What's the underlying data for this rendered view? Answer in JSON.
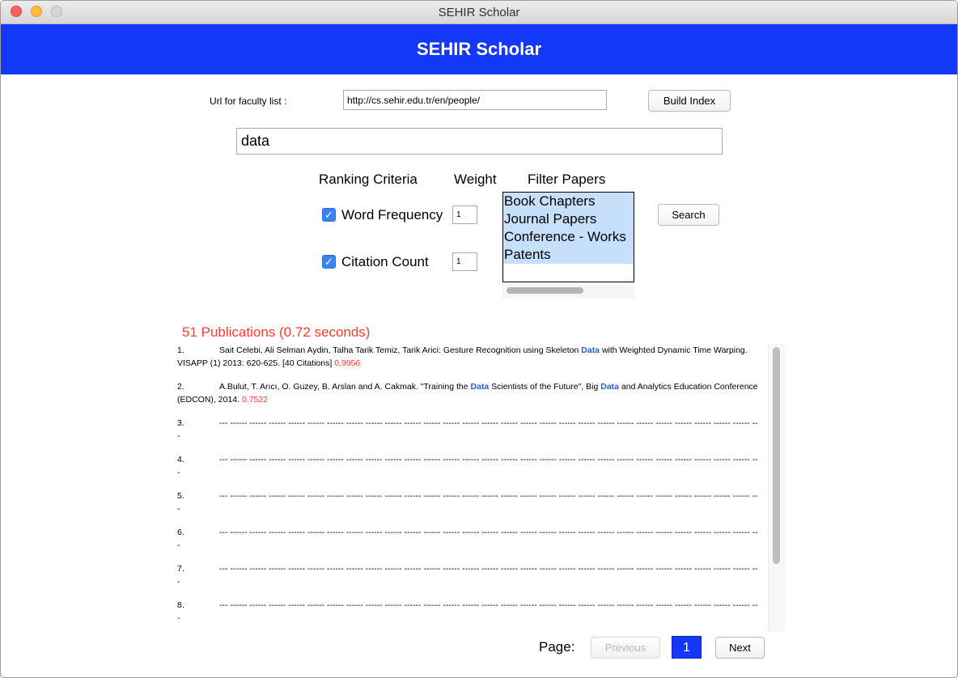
{
  "window": {
    "title": "SEHIR Scholar"
  },
  "header": {
    "title": "SEHIR Scholar"
  },
  "url_row": {
    "label": "Url for faculty list :",
    "value": "http://cs.sehir.edu.tr/en/people/",
    "build_button": "Build Index"
  },
  "query": {
    "value": "data"
  },
  "criteria": {
    "headers": {
      "ranking": "Ranking Criteria",
      "weight": "Weight",
      "filter": "Filter Papers"
    },
    "items": [
      {
        "label": "Word Frequency",
        "checked": true,
        "weight": "1"
      },
      {
        "label": "Citation Count",
        "checked": true,
        "weight": "1"
      }
    ],
    "check_glyph": "✓"
  },
  "filter": {
    "options": [
      "Book Chapters",
      "Journal Papers",
      "Conference - Works",
      "Patents"
    ]
  },
  "search_button": "Search",
  "results": {
    "count_text": "51 Publications (0.72 seconds)",
    "items": [
      {
        "num": "1.",
        "pre": "Sait Celebi, Ali Selman Aydin, Talha Tarik Temiz, Tarik Arici: Gesture Recognition using Skeleton ",
        "kw1": "Data",
        "mid": " with Weighted Dynamic Time Warping. VISAPP (1) 2013: 620-625. [40 Citations] ",
        "kw2": "",
        "post": "",
        "score": "0.9956"
      },
      {
        "num": "2.",
        "pre": "A.Bulut, T. Arıcı, O. Guzey, B. Arslan and A. Cakmak. \"Training the ",
        "kw1": "Data",
        "mid": " Scientists of the Future\", Big ",
        "kw2": "Data",
        "post": " and Analytics Education Conference (EDCON), 2014. ",
        "score": "0.7522"
      },
      {
        "num": "3.",
        "pre": "--- ------ ------ ------ ------ ------ ------ ------ ------ ------ ------ ------ ------ ------ ------ ------ ------ ------ ------ ------ ------ ------ ------ ------ ------ ------ ------ ------ ---",
        "kw1": "",
        "mid": "",
        "kw2": "",
        "post": "",
        "score": ""
      },
      {
        "num": "4.",
        "pre": "--- ------ ------ ------ ------ ------ ------ ------ ------ ------ ------ ------ ------ ------ ------ ------ ------ ------ ------ ------ ------ ------ ------ ------ ------ ------ ------ ------ ---",
        "kw1": "",
        "mid": "",
        "kw2": "",
        "post": "",
        "score": ""
      },
      {
        "num": "5.",
        "pre": "--- ------ ------ ------ ------ ------ ------ ------ ------ ------ ------ ------ ------ ------ ------ ------ ------ ------ ------ ------ ------ ------ ------ ------ ------ ------ ------ ------ ---",
        "kw1": "",
        "mid": "",
        "kw2": "",
        "post": "",
        "score": ""
      },
      {
        "num": "6.",
        "pre": "--- ------ ------ ------ ------ ------ ------ ------ ------ ------ ------ ------ ------ ------ ------ ------ ------ ------ ------ ------ ------ ------ ------ ------ ------ ------ ------ ------ ---",
        "kw1": "",
        "mid": "",
        "kw2": "",
        "post": "",
        "score": ""
      },
      {
        "num": "7.",
        "pre": "--- ------ ------ ------ ------ ------ ------ ------ ------ ------ ------ ------ ------ ------ ------ ------ ------ ------ ------ ------ ------ ------ ------ ------ ------ ------ ------ ------ ---",
        "kw1": "",
        "mid": "",
        "kw2": "",
        "post": "",
        "score": ""
      },
      {
        "num": "8.",
        "pre": "--- ------ ------ ------ ------ ------ ------ ------ ------ ------ ------ ------ ------ ------ ------ ------ ------ ------ ------ ------ ------ ------ ------ ------ ------ ------ ------ ------ ---",
        "kw1": "",
        "mid": "",
        "kw2": "",
        "post": "",
        "score": ""
      }
    ]
  },
  "pagination": {
    "label": "Page:",
    "previous": "Previous",
    "current": "1",
    "next": "Next"
  },
  "colors": {
    "header_blue": "#1438f8",
    "keyword_blue": "#2a5bd7",
    "score_red": "#ff3b30"
  }
}
